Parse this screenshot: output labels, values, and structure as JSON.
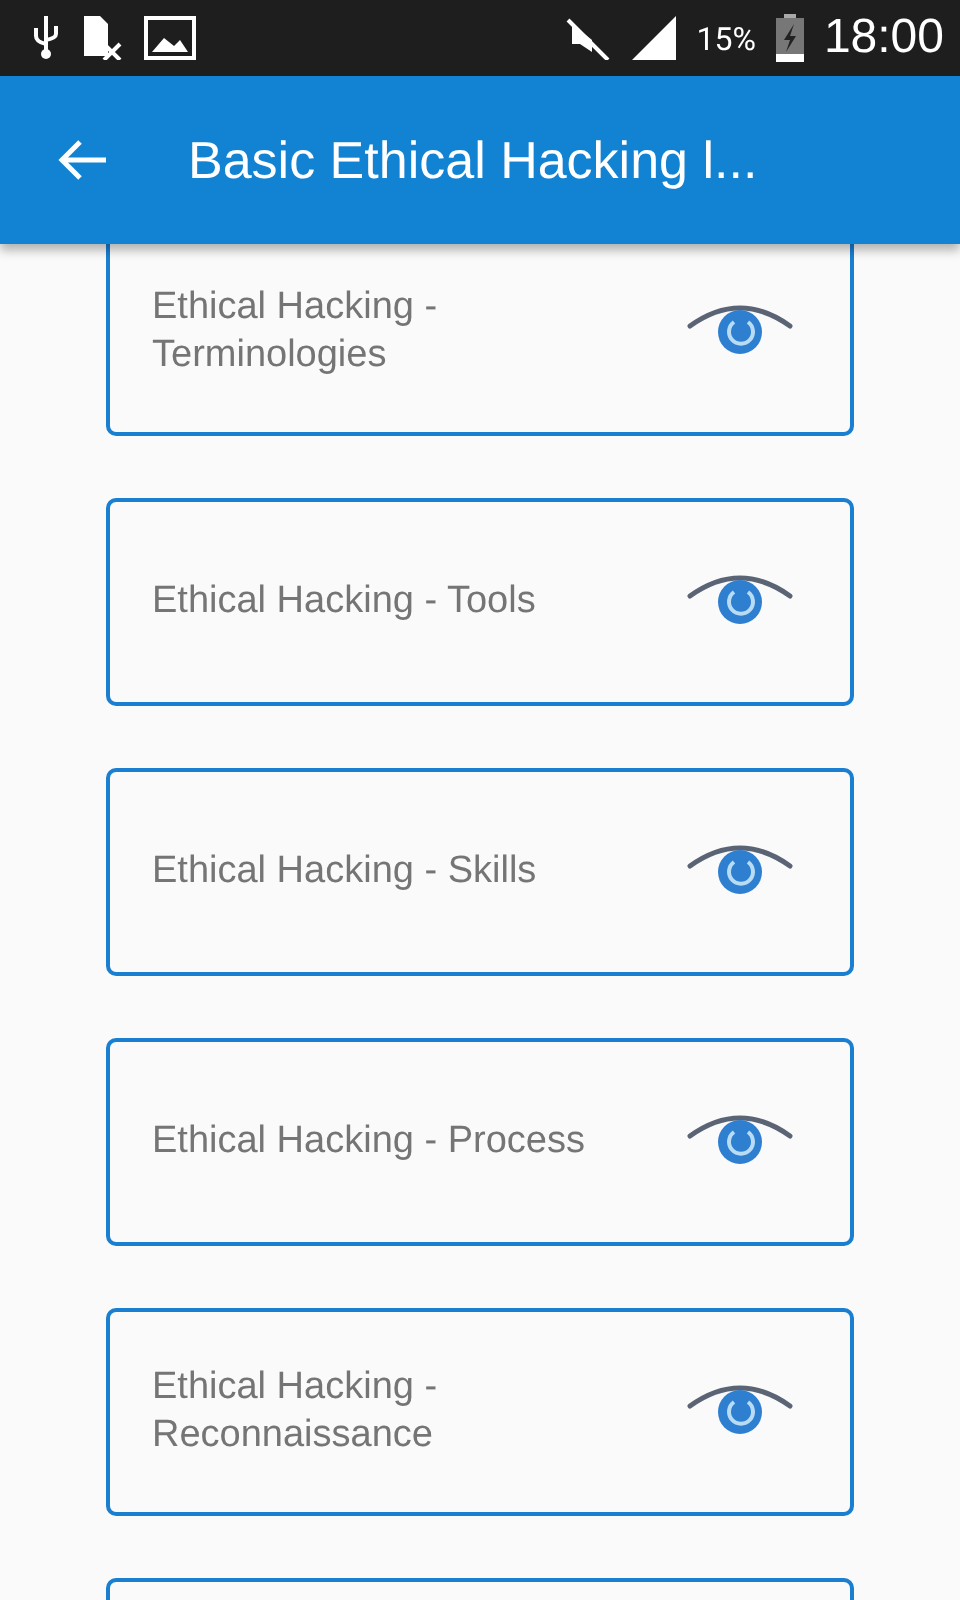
{
  "status_bar": {
    "battery": "15%",
    "time": "18:00"
  },
  "app_bar": {
    "title": "Basic Ethical Hacking l..."
  },
  "topics": [
    {
      "title": "Ethical Hacking - Terminologies"
    },
    {
      "title": "Ethical Hacking - Tools"
    },
    {
      "title": "Ethical Hacking - Skills"
    },
    {
      "title": "Ethical Hacking - Process"
    },
    {
      "title": "Ethical Hacking - Reconnaissance"
    }
  ]
}
